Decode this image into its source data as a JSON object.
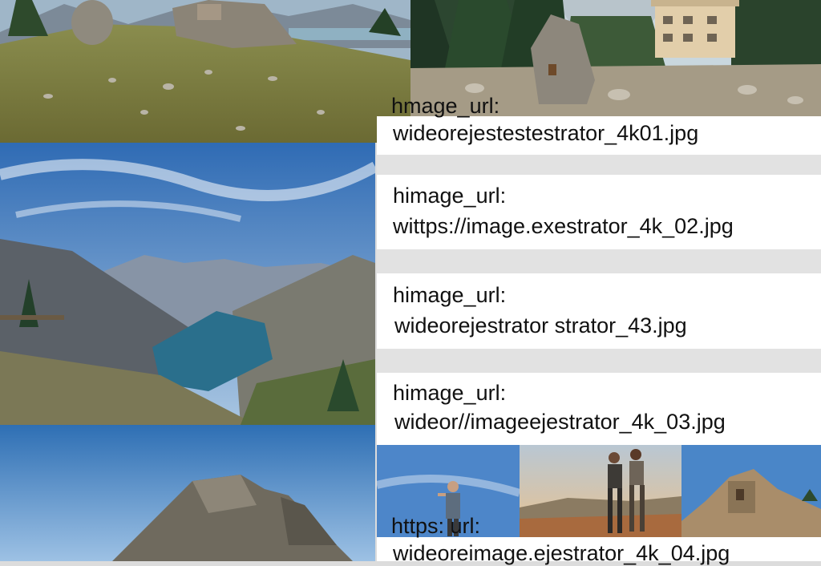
{
  "captions": [
    {
      "key": "hmage_url:",
      "value": "wideorejestestestrator_4k01.jpg"
    },
    {
      "key": "himage_url:",
      "value": "wittps://image.exestrator_4k_02.jpg"
    },
    {
      "key": "himage_url:",
      "value": "wideorejestrator strator_43.jpg"
    },
    {
      "key": "himage_url:",
      "value": "wideor//imageejestrator_4k_03.jpg"
    },
    {
      "key": "https: url:",
      "value": "wideoreimage.ejestrator_4k_04.jpg"
    }
  ],
  "photos": [
    {
      "name": "alpine-meadow-boulders-photo"
    },
    {
      "name": "forest-rock-and-house-photo"
    },
    {
      "name": "mountain-lake-valley-photo"
    },
    {
      "name": "rocky-peak-blue-sky-photo"
    },
    {
      "name": "hiker-photo"
    },
    {
      "name": "two-hikers-sunset-photo"
    },
    {
      "name": "rock-ruins-photo"
    }
  ]
}
